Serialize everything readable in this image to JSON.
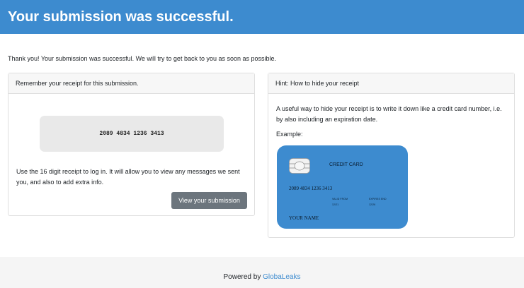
{
  "header": {
    "title": "Your submission was successful."
  },
  "intro_text": "Thank you! Your submission was successful. We will try to get back to you as soon as possible.",
  "receipt_card": {
    "header": "Remember your receipt for this submission.",
    "receipt": "2089 4834 1236 3413",
    "description": "Use the 16 digit receipt to log in. It will allow you to view any messages we sent you, and also to add extra info.",
    "button_label": "View your submission"
  },
  "hint_card": {
    "header": "Hint: How to hide your receipt",
    "text": "A useful way to hide your receipt is to write it down like a credit card number, i.e. by also including an expiration date.",
    "example_label": "Example:",
    "credit_card": {
      "title": "CREDIT CARD",
      "number": "2089 4834 1236 3413",
      "valid_from_label": "VALID FROM",
      "valid_from_value": "12/21",
      "expires_label": "EXPIRES END",
      "expires_value": "12/26",
      "name": "YOUR NAME",
      "chip_icon": "chip-icon",
      "card_color": "#3d8bcf"
    }
  },
  "footer": {
    "prefix": "Powered by ",
    "link_text": "GlobaLeaks"
  },
  "colors": {
    "header_bg": "#3d8bcf",
    "button_bg": "#6c757d",
    "link": "#3d8bcf"
  }
}
